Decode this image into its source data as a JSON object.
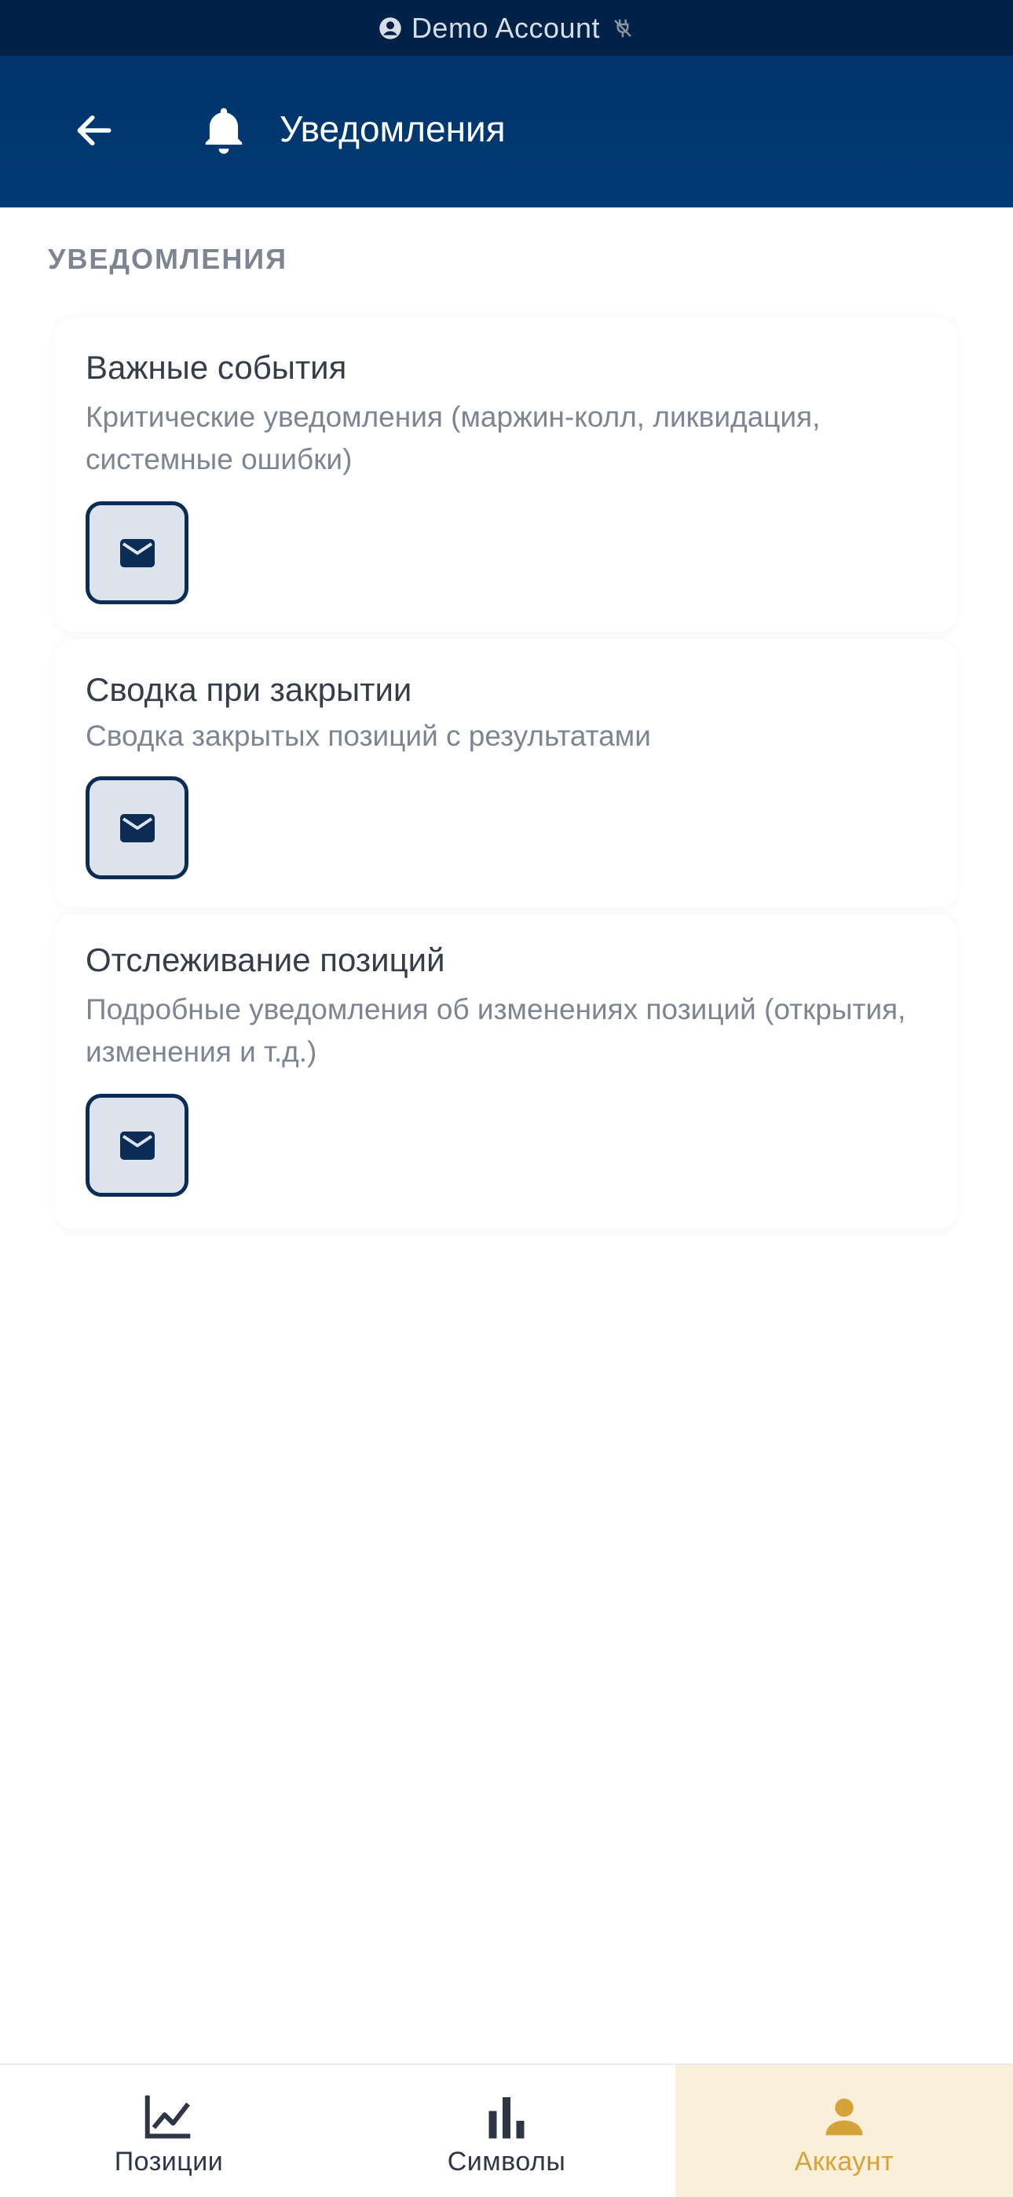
{
  "status_bar": {
    "account_label": "Demo Account",
    "account_icon": "account-circle-icon",
    "connection_icon": "disconnected-icon"
  },
  "header": {
    "title": "Уведомления",
    "back_icon": "arrow-left-icon",
    "title_icon": "bell-icon"
  },
  "section": {
    "label": "УВЕДОМЛЕНИЯ"
  },
  "cards": [
    {
      "title": "Важные события",
      "description": "Критические уведомления (маржин-колл, ликвидация, системные ошибки)",
      "channel_icon": "mail-icon"
    },
    {
      "title": "Сводка при закрытии",
      "description": "Сводка закрытых позиций с результатами",
      "channel_icon": "mail-icon"
    },
    {
      "title": "Отслеживание позиций",
      "description": "Подробные уведомления об изменениях позиций (открытия, изменения и т.д.)",
      "channel_icon": "mail-icon"
    }
  ],
  "bottom_nav": [
    {
      "label": "Позиции",
      "icon": "line-chart-icon",
      "active": false
    },
    {
      "label": "Символы",
      "icon": "bar-chart-icon",
      "active": false
    },
    {
      "label": "Аккаунт",
      "icon": "person-icon",
      "active": true
    }
  ],
  "colors": {
    "accent": "#d6a23a",
    "header": "#013a74",
    "status_bar": "#012247",
    "button_border": "#0b2d55"
  }
}
